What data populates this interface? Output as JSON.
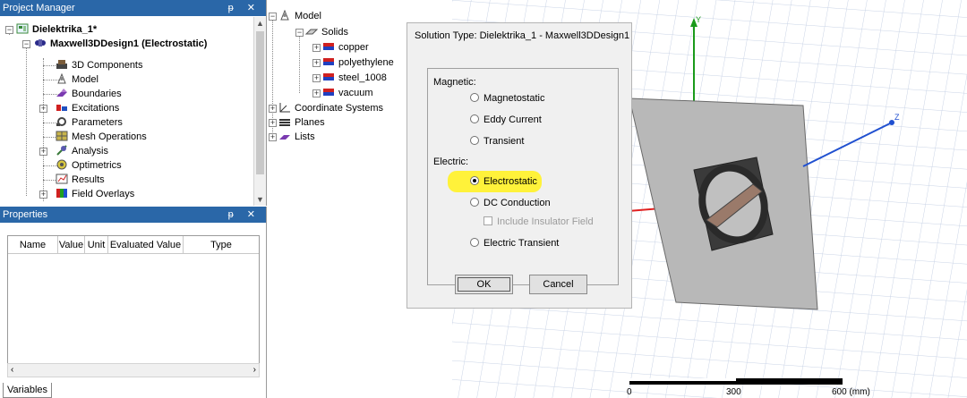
{
  "project_manager": {
    "title": "Project Manager",
    "title_buttons": "ᵽ ✕",
    "tree": [
      {
        "label": "Dielektrika_1*",
        "icon": "project-icon"
      },
      {
        "label": "Maxwell3DDesign1 (Electrostatic)",
        "icon": "design-icon"
      },
      {
        "label": "3D Components",
        "icon": "components-icon"
      },
      {
        "label": "Model",
        "icon": "model-icon"
      },
      {
        "label": "Boundaries",
        "icon": "boundaries-icon"
      },
      {
        "label": "Excitations",
        "icon": "excitations-icon"
      },
      {
        "label": "Parameters",
        "icon": "parameters-icon"
      },
      {
        "label": "Mesh Operations",
        "icon": "mesh-icon"
      },
      {
        "label": "Analysis",
        "icon": "analysis-icon"
      },
      {
        "label": "Optimetrics",
        "icon": "optimetrics-icon"
      },
      {
        "label": "Results",
        "icon": "results-icon"
      },
      {
        "label": "Field Overlays",
        "icon": "field-overlays-icon"
      }
    ]
  },
  "properties": {
    "title": "Properties",
    "title_buttons": "ᵽ ✕",
    "columns": [
      "Name",
      "Value",
      "Unit",
      "Evaluated Value",
      "Type"
    ],
    "tab": "Variables"
  },
  "model_tree": {
    "items": [
      {
        "label": "Model"
      },
      {
        "label": "Solids"
      },
      {
        "label": "copper"
      },
      {
        "label": "polyethylene"
      },
      {
        "label": "steel_1008"
      },
      {
        "label": "vacuum"
      },
      {
        "label": "Coordinate Systems"
      },
      {
        "label": "Planes"
      },
      {
        "label": "Lists"
      }
    ]
  },
  "dialog": {
    "title": "Solution Type: Dielektrika_1 - Maxwell3DDesign1",
    "magnetic_label": "Magnetic:",
    "electric_label": "Electric:",
    "options": {
      "magnetostatic": "Magnetostatic",
      "eddy_current": "Eddy Current",
      "transient": "Transient",
      "electrostatic": "Electrostatic",
      "dc_conduction": "DC Conduction",
      "include_insulator": "Include Insulator Field",
      "electric_transient": "Electric Transient"
    },
    "selected": "electrostatic",
    "ok_label": "OK",
    "cancel_label": "Cancel",
    "highlight_color": "#fff23a"
  },
  "viewport": {
    "axis_y": "Y",
    "axis_z": "Z",
    "scale_labels": [
      "0",
      "300",
      "600 (mm)"
    ],
    "axis_colors": {
      "x": "#e02020",
      "y": "#1a9a1a",
      "z": "#2050d0"
    }
  }
}
